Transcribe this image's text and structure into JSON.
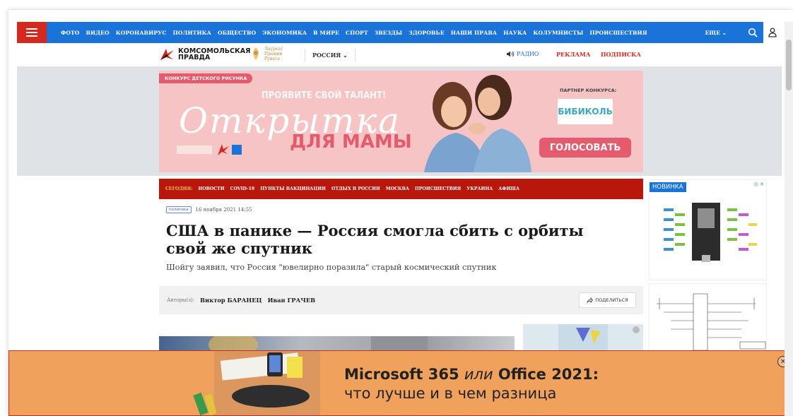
{
  "nav": {
    "links": [
      "ФОТО",
      "ВИДЕО",
      "КОРОНАВИРУС",
      "ПОЛИТИКА",
      "ОБЩЕСТВО",
      "ЭКОНОМИКА",
      "В МИРЕ",
      "СПОРТ",
      "ЗВЕЗДЫ",
      "ЗДОРОВЬЕ",
      "НАШИ ПРАВА",
      "НАУКА",
      "КОЛУМНИСТЫ",
      "ПРОИСШЕСТВИЯ"
    ],
    "more": "ЕЩЕ ⌄"
  },
  "subheader": {
    "logo_line1": "КОМСОМОЛЬСКАЯ",
    "logo_line2": "ПРАВДА",
    "laureat": "Лауреат Премии Рунета",
    "region": "РОССИЯ ⌄",
    "radio": "РАДИО",
    "reklama": "РЕКЛАМА",
    "podpiska": "ПОДПИСКА"
  },
  "banner": {
    "tag": "КОНКУРС ДЕТСКОГО РИСУНКА",
    "slogan": "ПРОЯВИТЕ СВОЙ ТАЛАНТ!",
    "title": "Открытка",
    "subtitle": "ДЛЯ МАМЫ",
    "partner": "ПАРТНЕР КОНКУРСА:",
    "partner_name": "БИБИКОЛЬ",
    "cta": "ГОЛОСОВАТЬ"
  },
  "todaybar": {
    "label": "СЕГОДНЯ:",
    "items": [
      "НОВОСТИ",
      "COVID-19",
      "ПУНКТЫ ВАКЦИНАЦИИ",
      "ОТДЫХ В РОССИИ",
      "МОСКВА",
      "ПРОИСШЕСТВИЯ",
      "УКРАИНА",
      "АФИША"
    ]
  },
  "article": {
    "category": "политика",
    "date": "16 ноября 2021 14:55",
    "headline": "США в панике — Россия смогла сбить с орбиты свой же спутник",
    "lead": "Шойгу заявил, что Россия \"ювелирно поразила\" старый космический спутник",
    "authors_label": "Авторы(з):",
    "author1": "Виктор БАРАНЕЦ",
    "author2": "Иван ГРАЧЕВ",
    "share": "ПОДЕЛИТЬСЯ"
  },
  "sidebar": {
    "badge": "НОВИНКА",
    "ad_marker": "◎ ✕"
  },
  "bottom_ad": {
    "title_a": "Microsoft 365 ",
    "title_or": "или",
    "title_b": " Office 2021:",
    "subtitle": "что лучше и в чем разница",
    "close": "✕"
  },
  "colors": {
    "nav_blue": "#1a73d9",
    "brand_red": "#d4291f",
    "dark_red_bar": "#b9170c",
    "banner_pink": "#f6c4c4",
    "ad_orange": "#f0a25c"
  }
}
